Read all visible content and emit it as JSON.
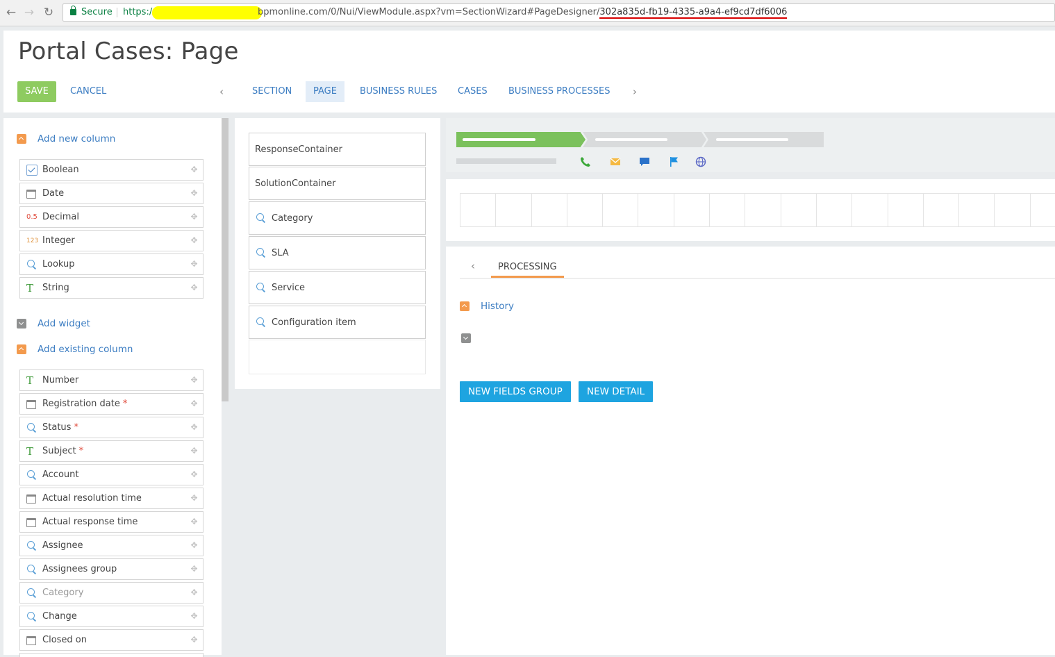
{
  "browser": {
    "secure_label": "Secure",
    "url_scheme": "https://",
    "url_path": "bpmonline.com/0/Nui/ViewModule.aspx?vm=SectionWizard#PageDesigner/",
    "url_id": "302a835d-fb19-4335-a9a4-ef9cd7df6006"
  },
  "header": {
    "title": "Portal Cases: Page",
    "save_label": "SAVE",
    "cancel_label": "CANCEL",
    "tabs": [
      {
        "label": "SECTION"
      },
      {
        "label": "PAGE"
      },
      {
        "label": "BUSINESS RULES"
      },
      {
        "label": "CASES"
      },
      {
        "label": "BUSINESS PROCESSES"
      }
    ]
  },
  "left": {
    "add_new_column": "Add new column",
    "new_columns": [
      {
        "label": "Boolean",
        "icon": "checkbox-icon"
      },
      {
        "label": "Date",
        "icon": "calendar-icon"
      },
      {
        "label": "Decimal",
        "icon": "decimal-icon",
        "badge": "0.5"
      },
      {
        "label": "Integer",
        "icon": "integer-icon",
        "badge": "123"
      },
      {
        "label": "Lookup",
        "icon": "search-icon"
      },
      {
        "label": "String",
        "icon": "text-icon",
        "badge": "T"
      }
    ],
    "add_widget": "Add widget",
    "add_existing_column": "Add existing column",
    "existing_columns": [
      {
        "label": "Number",
        "icon": "text-icon",
        "badge": "T",
        "required": false
      },
      {
        "label": "Registration date",
        "icon": "calendar-icon",
        "required": true
      },
      {
        "label": "Status",
        "icon": "search-icon",
        "required": true
      },
      {
        "label": "Subject",
        "icon": "text-icon",
        "badge": "T",
        "required": true
      },
      {
        "label": "Account",
        "icon": "search-icon",
        "required": false
      },
      {
        "label": "Actual resolution time",
        "icon": "calendar-icon",
        "required": false
      },
      {
        "label": "Actual response time",
        "icon": "calendar-icon",
        "required": false
      },
      {
        "label": "Assignee",
        "icon": "search-icon",
        "required": false
      },
      {
        "label": "Assignees group",
        "icon": "search-icon",
        "required": false
      },
      {
        "label": "Category",
        "icon": "search-icon",
        "required": false,
        "dimmed": true
      },
      {
        "label": "Change",
        "icon": "search-icon",
        "required": false
      },
      {
        "label": "Closed on",
        "icon": "calendar-icon",
        "required": false
      }
    ],
    "required_mark": "*"
  },
  "middle": {
    "containers": [
      {
        "label": "ResponseContainer",
        "icon": ""
      },
      {
        "label": "SolutionContainer",
        "icon": ""
      },
      {
        "label": "Category",
        "icon": "search-icon"
      },
      {
        "label": "SLA",
        "icon": "search-icon"
      },
      {
        "label": "Service",
        "icon": "search-icon"
      },
      {
        "label": "Configuration item",
        "icon": "search-icon"
      }
    ]
  },
  "right": {
    "stage_colors": {
      "active": "#7bc15c",
      "inactive": "#d9dbdc"
    },
    "actions": [
      "phone-icon",
      "email-icon",
      "chat-icon",
      "flag-icon",
      "globe-icon"
    ],
    "tab_label": "PROCESSING",
    "history_label": "History",
    "new_fields_group_label": "NEW FIELDS GROUP",
    "new_detail_label": "NEW DETAIL"
  }
}
